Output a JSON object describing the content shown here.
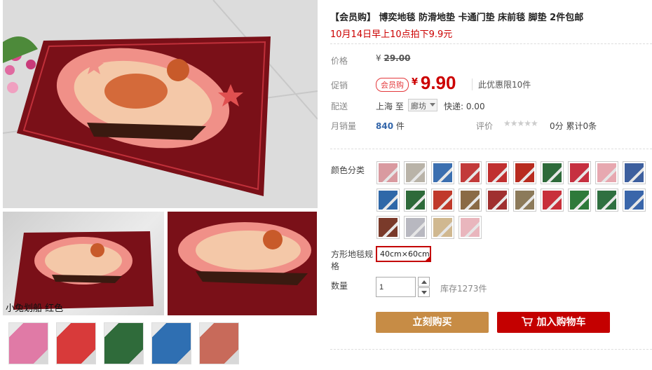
{
  "product": {
    "title": "【会员购】 博奕地毯 防滑地垫 卡通门垫 床前毯 脚垫 2件包邮",
    "subtitle": "10月14日早上10点拍下9.9元"
  },
  "gallery": {
    "caption": "小兔划船  红色",
    "main_color": "#7a1018",
    "thumb_colors": [
      "#e07aa6",
      "#d83a3a",
      "#2f6b3a",
      "#2f6fb2",
      "#c86a5a"
    ]
  },
  "price": {
    "label": "价格",
    "currency": "¥",
    "original": "29.00"
  },
  "promo": {
    "label": "促销",
    "tag": "会员购",
    "currency": "¥",
    "price": "9.90",
    "note": "此优惠限10件"
  },
  "shipping": {
    "label": "配送",
    "from": "上海",
    "to_word": "至",
    "dest": "廊坊",
    "fee": "快递: 0.00"
  },
  "sales": {
    "label": "月销量",
    "count": "840",
    "unit": "件",
    "review_label": "评价",
    "stars": "★★★★★",
    "score": "0分  累计0条"
  },
  "color_options": {
    "label": "颜色分类",
    "swatches": [
      "#d99aa0",
      "#b9b3a8",
      "#3b6fb0",
      "#c23a3a",
      "#c03030",
      "#b82b1f",
      "#2e6a3a",
      "#c63040",
      "#e7a8b0",
      "#3d5f9e",
      "#2f68a8",
      "#2e6a3a",
      "#c0392b",
      "#8a6a45",
      "#a03030",
      "#8c7a5a",
      "#c8303a",
      "#2e7a3a",
      "#2f7040",
      "#3a66aa",
      "#7a3a2a",
      "#b8b8c0",
      "#d0b890",
      "#e9b6bd"
    ]
  },
  "size": {
    "label": "方形地毯规格",
    "selected": "40cm×60cm"
  },
  "quantity": {
    "label": "数量",
    "value": "1",
    "stock": "库存1273件"
  },
  "actions": {
    "buy_now": "立刻购买",
    "add_to_cart": "加入购物车"
  }
}
